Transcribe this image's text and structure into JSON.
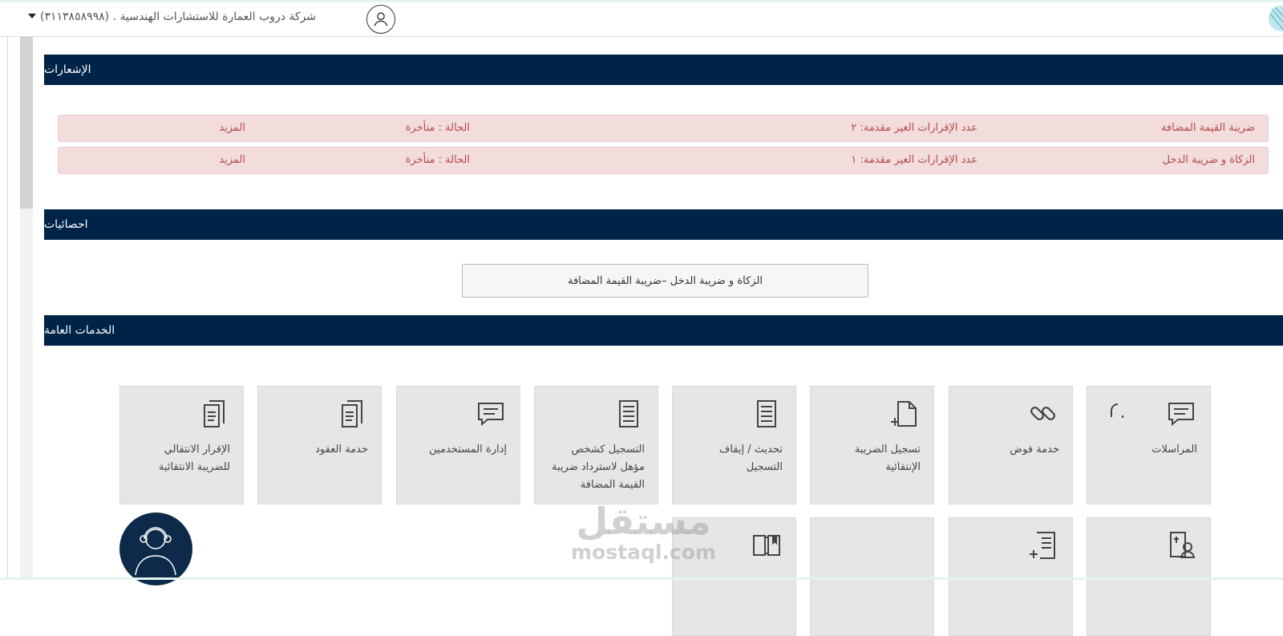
{
  "header": {
    "company": "شركة دروب العمارة للاستشارات الهندسية . (٣١١٣٨٥٨٩٩٨)",
    "user_icon": "user-icon",
    "menu_icon": "caret-down-icon"
  },
  "notifications": {
    "title": "الإشعارات",
    "rows": [
      {
        "service": "ضريبة القيمة المضافة",
        "count": "عدد الإقرارات الغير مقدمة: ٢",
        "status": "الحالة : متأخرة",
        "more": "المزيد"
      },
      {
        "service": "الزكاة و ضريبة الدخل",
        "count": "عدد الإقرارات الغير مقدمة: ١",
        "status": "الحالة : متأخرة",
        "more": "المزيد"
      }
    ]
  },
  "stats": {
    "title": "احصائيات",
    "button": "الزكاة و ضريبة الدخل –ضريبة القيمة المضافة"
  },
  "services": {
    "title": "الخدمات العامة",
    "tiles": [
      {
        "label": "المراسلات",
        "icon": "chat-icon"
      },
      {
        "label": "خدمة فوض",
        "icon": "link-icon"
      },
      {
        "label": "تسجيل الضريبة الإنتقائية",
        "icon": "document-add-icon"
      },
      {
        "label": "تحديث / إيقاف التسجيل",
        "icon": "document-list-icon"
      },
      {
        "label": "التسجيل كشخص مؤهل لاسترداد ضريبة القيمة المضافة",
        "icon": "document-list-icon"
      },
      {
        "label": "إدارة المستخدمين",
        "icon": "chat-icon"
      },
      {
        "label": "خدمة العقود",
        "icon": "document-icon"
      },
      {
        "label": "الإقرار الانتقالي للضريبة الانتقائية",
        "icon": "document-icon"
      }
    ],
    "row2_icons": [
      "user-invoice-icon",
      "list-add-icon",
      "blank",
      "book-icon"
    ]
  },
  "watermark": {
    "arabic": "مستقل",
    "latin": "mostaql.com"
  },
  "colors": {
    "navy": "#002348",
    "notif_bg": "#f3dcdc",
    "notif_text": "#b44a4a",
    "tile_bg": "#e6e6e6"
  }
}
